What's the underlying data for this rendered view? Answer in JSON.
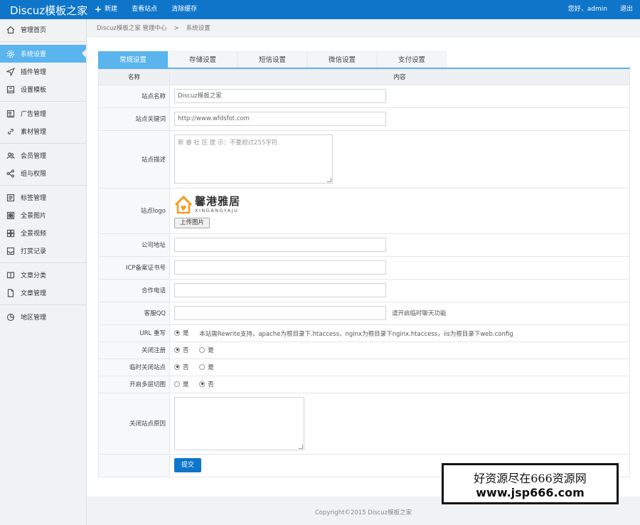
{
  "header": {
    "brand": "Discuz模板之家",
    "nav": [
      {
        "label": "新建",
        "icon": "plus-icon"
      },
      {
        "label": "查看站点"
      },
      {
        "label": "清除缓存"
      }
    ],
    "greeting": "您好，admin",
    "logout": "退出"
  },
  "sidebar": {
    "items": [
      {
        "label": "管理首页",
        "icon": "home-icon"
      },
      {
        "label": "系统设置",
        "icon": "gear-icon",
        "active": true
      },
      {
        "label": "插件管理",
        "icon": "send-icon"
      },
      {
        "label": "设置模板",
        "icon": "layout-icon"
      },
      {
        "label": "广告管理",
        "icon": "ad-icon"
      },
      {
        "label": "素材管理",
        "icon": "link-icon"
      },
      {
        "label": "会员管理",
        "icon": "users-icon"
      },
      {
        "label": "组与权限",
        "icon": "share-icon"
      },
      {
        "label": "标签管理",
        "icon": "list-icon"
      },
      {
        "label": "全景图片",
        "icon": "image-grid-icon"
      },
      {
        "label": "全景视频",
        "icon": "video-grid-icon"
      },
      {
        "label": "打赏记录",
        "icon": "inbox-icon"
      },
      {
        "label": "文章分类",
        "icon": "book-icon"
      },
      {
        "label": "文章管理",
        "icon": "document-icon"
      },
      {
        "label": "地区管理",
        "icon": "pie-icon"
      }
    ]
  },
  "breadcrumb": {
    "root": "Discuz模板之家 管理中心",
    "sep": ">",
    "current": "系统设置"
  },
  "tabs": [
    "常规设置",
    "存储设置",
    "短信设置",
    "微信设置",
    "支付设置"
  ],
  "form": {
    "col_name": "名称",
    "col_content": "内容",
    "site_name": {
      "label": "站点名称",
      "value": "Discuz模板之家"
    },
    "site_keywords": {
      "label": "站点关键词",
      "value": "http://www.wfdsfot.com"
    },
    "site_desc": {
      "label": "站点描述",
      "placeholder": "新 睿 社 区 提 示：不要超过255字符"
    },
    "site_logo": {
      "label": "站点logo",
      "logo_cn": "馨港雅居",
      "logo_en": "XINGANGYAJU",
      "upload_label": "上传图片"
    },
    "company_address": {
      "label": "公司地址",
      "value": ""
    },
    "icp": {
      "label": "ICP备案证书号",
      "value": ""
    },
    "phone": {
      "label": "合作电话",
      "value": ""
    },
    "qq": {
      "label": "客服QQ",
      "value": "",
      "hint": "请开启临时聊天功能"
    },
    "url_rewrite": {
      "label": "URL 重写",
      "option": "是",
      "hint": "本站需Rewrite支持，apache为根目录下.htaccess，nginx为根目录下nginx.htaccess，iis为根目录下web.config"
    },
    "close_register": {
      "label": "关闭注册",
      "no": "否",
      "yes": "是"
    },
    "temp_close": {
      "label": "临时关闭站点",
      "no": "否",
      "yes": "是"
    },
    "multi_layer": {
      "label": "开启多层切图",
      "yes": "是",
      "no": "否"
    },
    "close_reason": {
      "label": "关闭站点原因"
    },
    "submit": "提交"
  },
  "footer": "Copyright©2015  Discuz模板之家",
  "watermark": {
    "line1": "好资源尽在666资源网",
    "line2": "www.jsp666.com"
  },
  "colors": {
    "primary": "#0e75c9",
    "accent": "#5ab4ed"
  }
}
